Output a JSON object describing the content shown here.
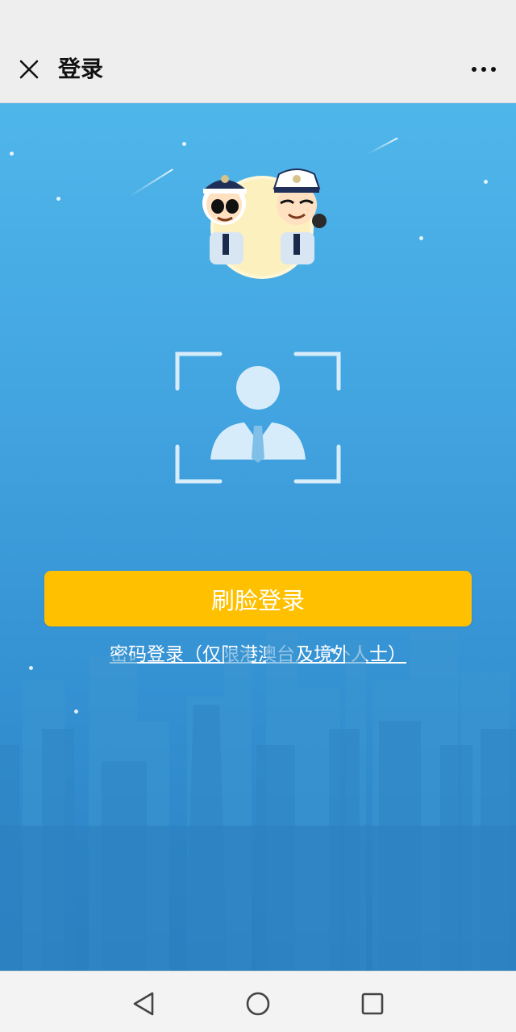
{
  "window": {
    "title": "登录"
  },
  "icons": {
    "close": "close-icon",
    "more": "more-icon",
    "face_frame": "face-frame-icon",
    "back": "back-triangle-icon",
    "home": "home-circle-icon",
    "recents": "recents-square-icon"
  },
  "main": {
    "face_login_label": "刷脸登录",
    "password_login_label": "密码登录（仅限港澳台及境外人士）"
  },
  "colors": {
    "primary_button": "#ffc000",
    "background_top": "#4fb6ea",
    "background_bottom": "#2a80c2"
  }
}
